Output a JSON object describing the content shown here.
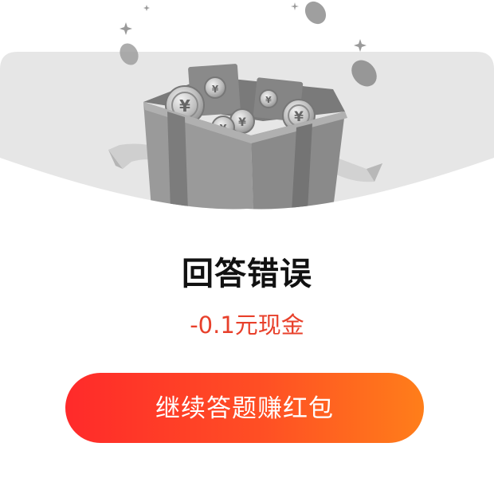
{
  "result": {
    "title": "回答错误",
    "penalty": "-0.1元现金"
  },
  "actions": {
    "continue_label": "继续答题赚红包"
  },
  "illustration": {
    "coin_symbol": "¥",
    "icon": "gift-box-with-coins-icon"
  },
  "colors": {
    "panel": "#e6e6e6",
    "penalty_text": "#e8402b",
    "button_gradient_start": "#ff2a2a",
    "button_gradient_end": "#ff7e1a"
  }
}
